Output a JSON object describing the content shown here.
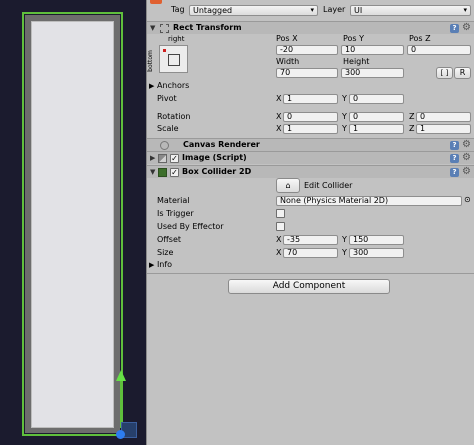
{
  "header": {
    "tag_label": "Tag",
    "tag_value": "Untagged",
    "layer_label": "Layer",
    "layer_value": "UI"
  },
  "rect_transform": {
    "title": "Rect Transform",
    "anchor_preset_top": "right",
    "anchor_preset_side": "bottom",
    "col_headers": [
      "Pos X",
      "Pos Y",
      "Pos Z"
    ],
    "pos_x": "-20",
    "pos_y": "10",
    "pos_z": "0",
    "width_label": "Width",
    "height_label": "Height",
    "width": "70",
    "height": "300",
    "raw_label": "R",
    "anchors_label": "Anchors",
    "pivot_label": "Pivot",
    "pivot_x": "1",
    "pivot_y": "0",
    "rotation_label": "Rotation",
    "rot_x": "0",
    "rot_y": "0",
    "rot_z": "0",
    "scale_label": "Scale",
    "scale_x": "1",
    "scale_y": "1",
    "scale_z": "1"
  },
  "axis": {
    "x": "X",
    "y": "Y",
    "z": "Z"
  },
  "canvas_renderer": {
    "title": "Canvas Renderer"
  },
  "image_script": {
    "title": "Image (Script)",
    "enabled": true
  },
  "box_collider": {
    "title": "Box Collider 2D",
    "enabled": true,
    "edit_collider_label": "Edit Collider",
    "material_label": "Material",
    "material_value": "None (Physics Material 2D)",
    "is_trigger_label": "Is Trigger",
    "used_by_effector_label": "Used By Effector",
    "offset_label": "Offset",
    "offset_x": "-35",
    "offset_y": "150",
    "size_label": "Size",
    "size_x": "70",
    "size_y": "300",
    "info_label": "Info"
  },
  "add_component_label": "Add Component",
  "colors": {
    "collider_outline": "#5fbf3c",
    "scene_background": "#1b1b2e",
    "inspector_background": "#c2c2c2"
  }
}
